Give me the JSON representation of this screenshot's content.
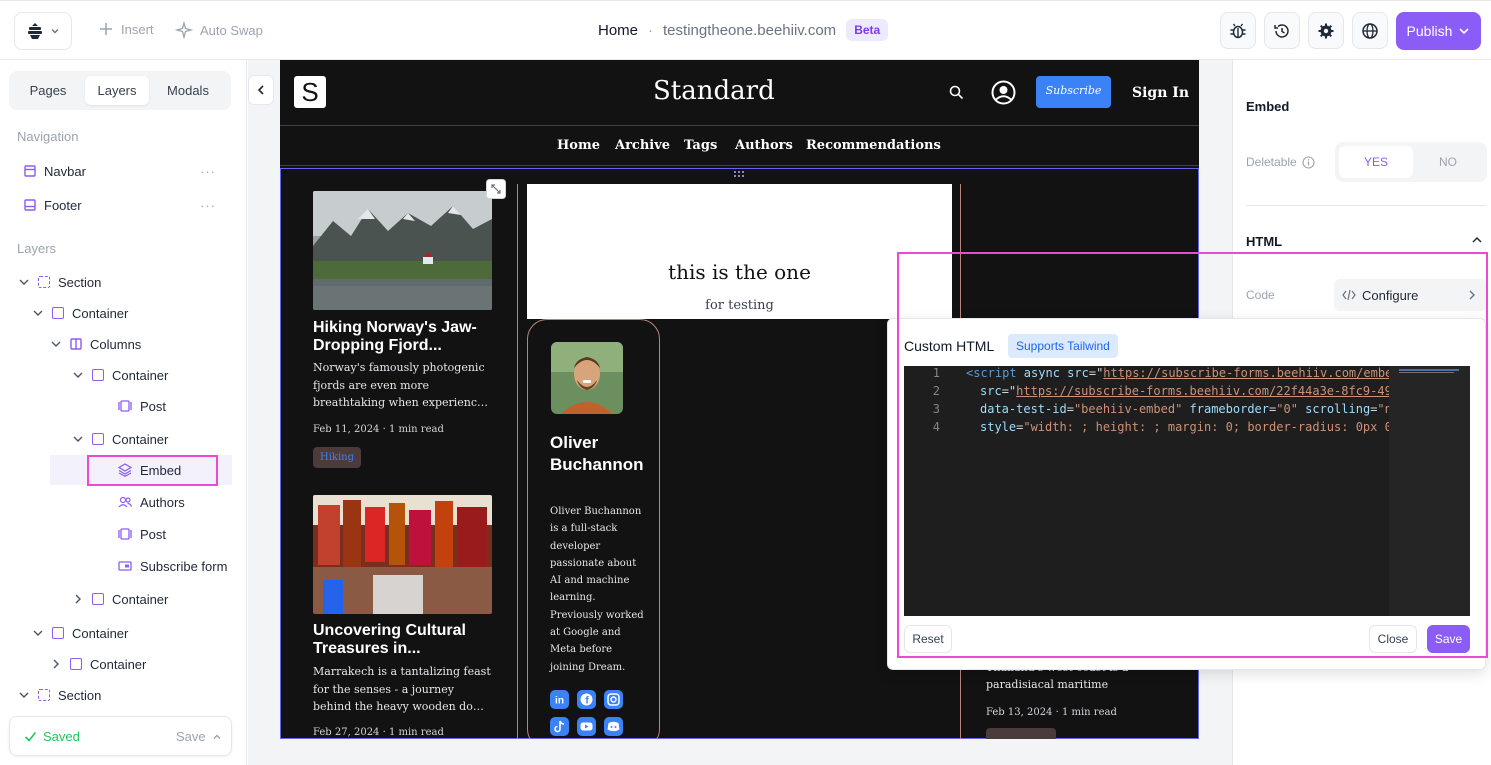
{
  "topbar": {
    "insert_label": "Insert",
    "autoswap_label": "Auto Swap",
    "page_name": "Home",
    "separator": "·",
    "domain": "testingtheone.beehiiv.com",
    "beta_badge": "Beta",
    "publish_label": "Publish",
    "icons": [
      "bug-icon",
      "history-icon",
      "settings-icon",
      "globe-icon"
    ]
  },
  "sidebar": {
    "tabs": [
      "Pages",
      "Layers",
      "Modals"
    ],
    "active_tab": "Layers",
    "navigation_heading": "Navigation",
    "navigation_items": [
      {
        "label": "Navbar",
        "more": "···"
      },
      {
        "label": "Footer",
        "more": "···"
      }
    ],
    "layers_heading": "Layers",
    "layers": [
      {
        "label": "Section"
      },
      {
        "label": "Container"
      },
      {
        "label": "Columns"
      },
      {
        "label": "Container"
      },
      {
        "label": "Post"
      },
      {
        "label": "Container"
      },
      {
        "label": "Embed"
      },
      {
        "label": "Authors"
      },
      {
        "label": "Post"
      },
      {
        "label": "Subscribe form"
      },
      {
        "label": "Container"
      },
      {
        "label": "Container"
      },
      {
        "label": "Container"
      },
      {
        "label": "Section"
      }
    ],
    "saved_status": "Saved",
    "save_label": "Save"
  },
  "site": {
    "logo_letter": "S",
    "title": "Standard",
    "subscribe_label": "Subscribe",
    "signin_label": "Sign In",
    "menu": [
      "Home",
      "Archive",
      "Tags",
      "Authors",
      "Recommendations"
    ],
    "posts": [
      {
        "title": "Hiking Norway's Jaw-Dropping Fjord...",
        "desc": "Norway's famously photogenic fjords are even more breathtaking when experienc…",
        "meta": "Feb 11, 2024 · 1 min read",
        "tag": "Hiking"
      },
      {
        "title": "Uncovering Cultural Treasures in...",
        "desc": "Marrakech is a tantalizing feast for the senses - a journey behind the heavy wooden do…",
        "meta": "Feb 27, 2024 · 1 min read"
      }
    ],
    "embed": {
      "title": "this is the one",
      "subtitle": "for testing"
    },
    "author": {
      "name": "Oliver Buchannon",
      "bio": "Oliver Buchannon is a full-stack developer passionate about AI and machine learning. Previously worked at Google and Meta before joining Dream.",
      "socials": [
        "linkedin-icon",
        "facebook-icon",
        "instagram-icon",
        "tiktok-icon",
        "youtube-icon",
        "discord-icon"
      ]
    },
    "right_post": {
      "desc_line1": "Thailand's west coast is a",
      "desc_line2": "paradisiacal maritime",
      "meta": "Feb 13, 2024 · 1 min read"
    }
  },
  "right_panel": {
    "heading": "Embed",
    "deletable_label": "Deletable",
    "yes_label": "YES",
    "no_label": "NO",
    "html_heading": "HTML",
    "code_label": "Code",
    "configure_label": "Configure"
  },
  "popover": {
    "title": "Custom HTML",
    "badge": "Supports Tailwind",
    "lines": [
      {
        "n": "1",
        "tag": "<script",
        "rest": " async ",
        "attr": "src",
        "eq": "=\"",
        "url": "https://subscribe-forms.beehiiv.com/embe"
      },
      {
        "n": "2",
        "attr": "src",
        "eq": "=\"",
        "url": "https://subscribe-forms.beehiiv.com/22f44a3e-8fc9-49"
      },
      {
        "n": "3",
        "attr": "data-test-id",
        "eq": "=",
        "val": "\"beehiiv-embed\"",
        "attr2": " frameborder",
        "eq2": "=",
        "val2": "\"0\"",
        "attr3": " scrolling",
        "eq3": "=",
        "val3": "\"n"
      },
      {
        "n": "4",
        "attr": "style",
        "eq": "=",
        "val": "\"width: ; height: ; margin: 0; border-radius: 0px 0"
      }
    ],
    "reset_label": "Reset",
    "close_label": "Close",
    "save_label": "Save"
  },
  "colors": {
    "accent": "#8b5cf6",
    "highlight": "#ec4ad6",
    "site_bg": "#121212",
    "link_blue": "#3b82f6",
    "saved_green": "#22c55e"
  }
}
